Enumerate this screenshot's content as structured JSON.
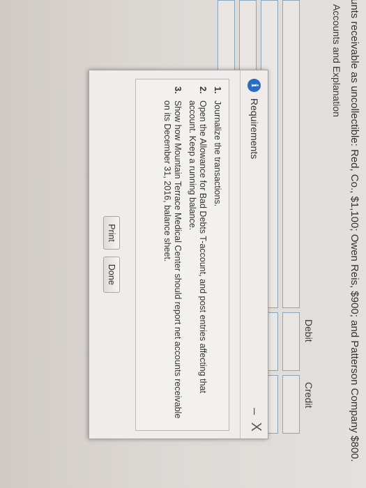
{
  "page": {
    "headline": "unts receivable as uncollectible: Red, Co., $1,100; Owen Reis, $900; and Patterson Company $800.",
    "columns": {
      "accounts": "Accounts and Explanation",
      "debit": "Debit",
      "credit": "Credit"
    }
  },
  "popup": {
    "title": "Requirements",
    "minimize": "–",
    "close": "X",
    "info_icon": "i",
    "requirements": [
      {
        "num": "1.",
        "text": "Journalize the transactions."
      },
      {
        "num": "2.",
        "text": "Open the Allowance for Bad Debts T-account, and post entries affecting that account. Keep a running balance."
      },
      {
        "num": "3.",
        "text": "Show how Mountain Terrace Medical Center should report net accounts receivable on its December 31, 2016, balance sheet."
      }
    ],
    "buttons": {
      "print": "Print",
      "done": "Done"
    }
  },
  "colors": {
    "info_icon": "#2a6cc4",
    "input_border": "#8aa4b8"
  }
}
